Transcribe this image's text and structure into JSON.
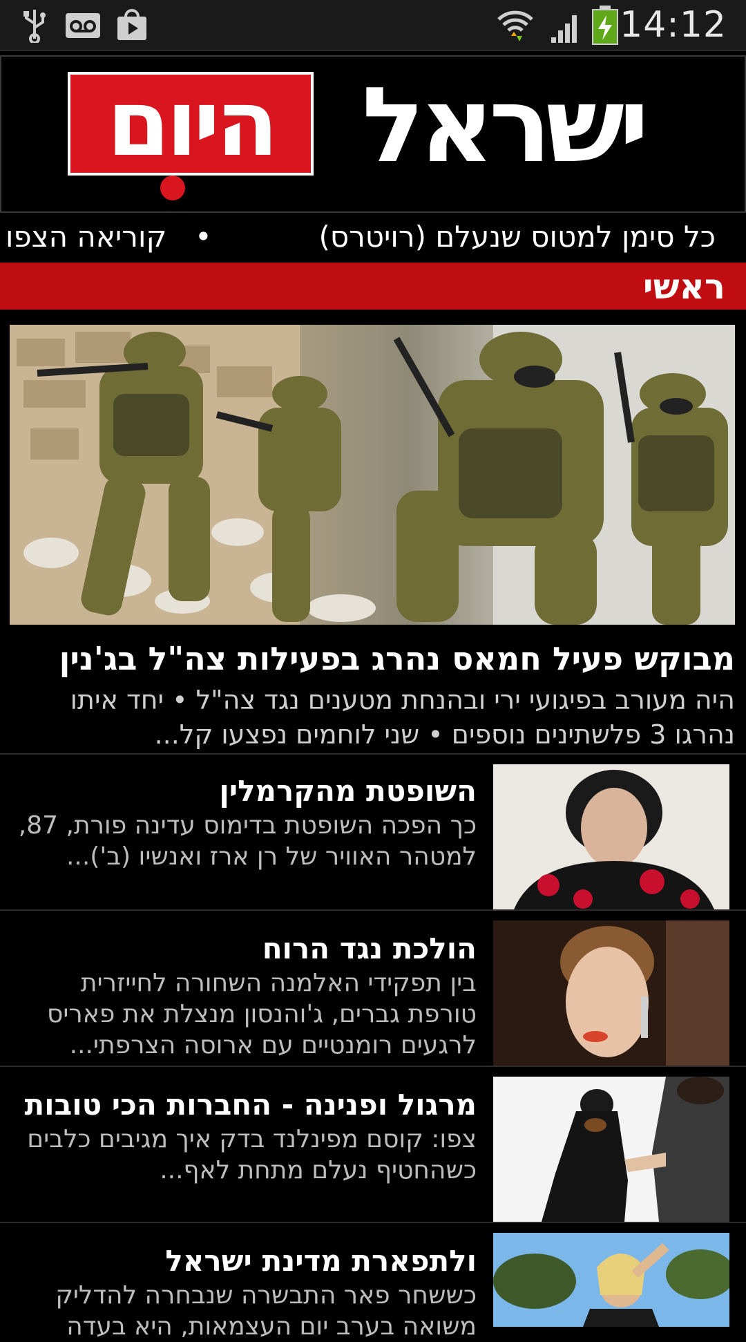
{
  "status_bar": {
    "time": "14:12",
    "icons": [
      "usb-icon",
      "voicemail-icon",
      "shopping-bag-icon",
      "wifi-icon",
      "signal-icon",
      "battery-charging-icon"
    ]
  },
  "header": {
    "logo_red_text": "היום",
    "logo_white_text": "ישראל"
  },
  "ticker": {
    "items": [
      "כל סימן למטוס שנעלם (רויטרס)",
      "קוריאה הצפו"
    ],
    "bullet": "•"
  },
  "section": {
    "title": "ראשי"
  },
  "hero": {
    "title": "מבוקש פעיל חמאס נהרג בפעילות צה\"ל בג'נין",
    "subtitle": "היה מעורב בפיגועי ירי ובהנחת מטענים נגד צה\"ל • יחד איתו נהרגו 3 פלשתינים נוספים • שני לוחמים נפצעו קל..."
  },
  "articles": [
    {
      "title": "השופטת מהקרמלין",
      "subtitle": "כך הפכה השופטת בדימוס עדינה פורת, 87, למטהר האוויר של רן ארז ואנשיו (ב')..."
    },
    {
      "title": "הולכת נגד הרוח",
      "subtitle": "בין תפקידי האלמנה השחורה לחייזרית טורפת גברים, ג'והנסון מנצלת את פאריס לרגעים רומנטיים עם ארוסה הצרפתי..."
    },
    {
      "title": "מרגול ופנינה - החברות הכי טובות",
      "subtitle": "צפו: קוסם מפינלנד בדק איך מגיבים כלבים כשהחטיף נעלם מתחת לאף..."
    },
    {
      "title": "ולתפארת מדינת ישראל",
      "subtitle": "כששחר פאר התבשרה שנבחרה להדליק משואה בערב יום העצמאות, היא בעדה"
    }
  ]
}
